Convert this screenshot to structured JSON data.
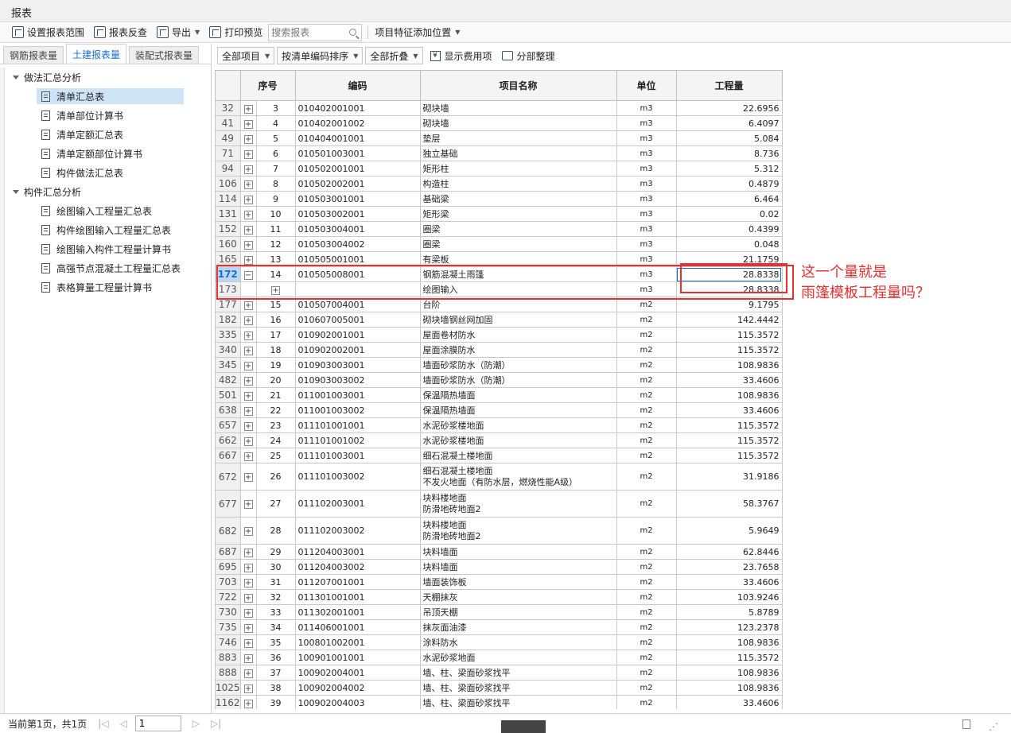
{
  "window": {
    "title": "报表"
  },
  "toolbar": {
    "set_range": "设置报表范围",
    "reverse_check": "报表反查",
    "export": "导出",
    "print_preview": "打印预览",
    "search_placeholder": "搜索报表",
    "feature_position": "项目特征添加位置"
  },
  "left_tabs": [
    "钢筋报表量",
    "土建报表量",
    "装配式报表量"
  ],
  "tree": {
    "groups": [
      {
        "label": "做法汇总分析",
        "items": [
          "清单汇总表",
          "清单部位计算书",
          "清单定额汇总表",
          "清单定额部位计算书",
          "构件做法汇总表"
        ]
      },
      {
        "label": "构件汇总分析",
        "items": [
          "绘图输入工程量汇总表",
          "构件绘图输入工程量汇总表",
          "绘图输入构件工程量计算书",
          "高强节点混凝土工程量汇总表",
          "表格算量工程量计算书"
        ]
      }
    ],
    "selected": "清单汇总表"
  },
  "right_toolbar": {
    "all_items": "全部项目",
    "sort_by_code": "按清单编码排序",
    "collapse_all": "全部折叠",
    "show_fee": "显示费用项",
    "section_arrange": "分部整理"
  },
  "table": {
    "headers": [
      "序号",
      "编码",
      "项目名称",
      "单位",
      "工程量"
    ],
    "rows": [
      {
        "rn": "32",
        "pm": "+",
        "seq": "3",
        "code": "010402001001",
        "name": "砌块墙",
        "unit": "m3",
        "qty": "22.6956"
      },
      {
        "rn": "41",
        "pm": "+",
        "seq": "4",
        "code": "010402001002",
        "name": "砌块墙",
        "unit": "m3",
        "qty": "6.4097"
      },
      {
        "rn": "49",
        "pm": "+",
        "seq": "5",
        "code": "010404001001",
        "name": "垫层",
        "unit": "m3",
        "qty": "5.084"
      },
      {
        "rn": "71",
        "pm": "+",
        "seq": "6",
        "code": "010501003001",
        "name": "独立基础",
        "unit": "m3",
        "qty": "8.736"
      },
      {
        "rn": "94",
        "pm": "+",
        "seq": "7",
        "code": "010502001001",
        "name": "矩形柱",
        "unit": "m3",
        "qty": "5.312"
      },
      {
        "rn": "106",
        "pm": "+",
        "seq": "8",
        "code": "010502002001",
        "name": "构造柱",
        "unit": "m3",
        "qty": "0.4879"
      },
      {
        "rn": "114",
        "pm": "+",
        "seq": "9",
        "code": "010503001001",
        "name": "基础梁",
        "unit": "m3",
        "qty": "6.464"
      },
      {
        "rn": "131",
        "pm": "+",
        "seq": "10",
        "code": "010503002001",
        "name": "矩形梁",
        "unit": "m3",
        "qty": "0.02"
      },
      {
        "rn": "152",
        "pm": "+",
        "seq": "11",
        "code": "010503004001",
        "name": "圈梁",
        "unit": "m3",
        "qty": "0.4399"
      },
      {
        "rn": "160",
        "pm": "+",
        "seq": "12",
        "code": "010503004002",
        "name": "圈梁",
        "unit": "m3",
        "qty": "0.048"
      },
      {
        "rn": "165",
        "pm": "+",
        "seq": "13",
        "code": "010505001001",
        "name": "有梁板",
        "unit": "m3",
        "qty": "21.1759"
      },
      {
        "rn": "172",
        "pm": "−",
        "seq": "14",
        "code": "010505008001",
        "name": "钢筋混凝土雨篷",
        "unit": "m3",
        "qty": "28.8338",
        "current": true
      },
      {
        "rn": "173",
        "pm": "",
        "sub": "+",
        "seq": "",
        "code": "",
        "name": "绘图输入",
        "unit": "m3",
        "qty": "28.8338"
      },
      {
        "rn": "177",
        "pm": "+",
        "seq": "15",
        "code": "010507004001",
        "name": "台阶",
        "unit": "m2",
        "qty": "9.1795"
      },
      {
        "rn": "182",
        "pm": "+",
        "seq": "16",
        "code": "010607005001",
        "name": "砌块墙钢丝网加固",
        "unit": "m2",
        "qty": "142.4442"
      },
      {
        "rn": "335",
        "pm": "+",
        "seq": "17",
        "code": "010902001001",
        "name": "屋面卷材防水",
        "unit": "m2",
        "qty": "115.3572"
      },
      {
        "rn": "340",
        "pm": "+",
        "seq": "18",
        "code": "010902002001",
        "name": "屋面涂膜防水",
        "unit": "m2",
        "qty": "115.3572"
      },
      {
        "rn": "345",
        "pm": "+",
        "seq": "19",
        "code": "010903003001",
        "name": "墙面砂浆防水（防潮）",
        "unit": "m2",
        "qty": "108.9836"
      },
      {
        "rn": "482",
        "pm": "+",
        "seq": "20",
        "code": "010903003002",
        "name": "墙面砂浆防水（防潮）",
        "unit": "m2",
        "qty": "33.4606"
      },
      {
        "rn": "501",
        "pm": "+",
        "seq": "21",
        "code": "011001003001",
        "name": "保温隔热墙面",
        "unit": "m2",
        "qty": "108.9836"
      },
      {
        "rn": "638",
        "pm": "+",
        "seq": "22",
        "code": "011001003002",
        "name": "保温隔热墙面",
        "unit": "m2",
        "qty": "33.4606"
      },
      {
        "rn": "657",
        "pm": "+",
        "seq": "23",
        "code": "011101001001",
        "name": "水泥砂浆楼地面",
        "unit": "m2",
        "qty": "115.3572"
      },
      {
        "rn": "662",
        "pm": "+",
        "seq": "24",
        "code": "011101001002",
        "name": "水泥砂浆楼地面",
        "unit": "m2",
        "qty": "115.3572"
      },
      {
        "rn": "667",
        "pm": "+",
        "seq": "25",
        "code": "011101003001",
        "name": "细石混凝土楼地面",
        "unit": "m2",
        "qty": "115.3572"
      },
      {
        "rn": "672",
        "pm": "+",
        "seq": "26",
        "code": "011101003002",
        "name": "细石混凝土楼地面",
        "name2": "不发火地面（有防水层，燃烧性能A级）",
        "unit": "m2",
        "qty": "31.9186"
      },
      {
        "rn": "677",
        "pm": "+",
        "seq": "27",
        "code": "011102003001",
        "name": "块料楼地面",
        "name2": "防滑地砖地面2",
        "unit": "m2",
        "qty": "58.3767"
      },
      {
        "rn": "682",
        "pm": "+",
        "seq": "28",
        "code": "011102003002",
        "name": "块料楼地面",
        "name2": "防滑地砖地面2",
        "unit": "m2",
        "qty": "5.9649"
      },
      {
        "rn": "687",
        "pm": "+",
        "seq": "29",
        "code": "011204003001",
        "name": "块料墙面",
        "unit": "m2",
        "qty": "62.8446"
      },
      {
        "rn": "695",
        "pm": "+",
        "seq": "30",
        "code": "011204003002",
        "name": "块料墙面",
        "unit": "m2",
        "qty": "23.7658"
      },
      {
        "rn": "703",
        "pm": "+",
        "seq": "31",
        "code": "011207001001",
        "name": "墙面装饰板",
        "unit": "m2",
        "qty": "33.4606"
      },
      {
        "rn": "722",
        "pm": "+",
        "seq": "32",
        "code": "011301001001",
        "name": "天棚抹灰",
        "unit": "m2",
        "qty": "103.9246"
      },
      {
        "rn": "730",
        "pm": "+",
        "seq": "33",
        "code": "011302001001",
        "name": "吊顶天棚",
        "unit": "m2",
        "qty": "5.8789"
      },
      {
        "rn": "735",
        "pm": "+",
        "seq": "34",
        "code": "011406001001",
        "name": "抹灰面油漆",
        "unit": "m2",
        "qty": "123.2378"
      },
      {
        "rn": "746",
        "pm": "+",
        "seq": "35",
        "code": "100801002001",
        "name": "涂料防水",
        "unit": "m2",
        "qty": "108.9836"
      },
      {
        "rn": "883",
        "pm": "+",
        "seq": "36",
        "code": "100901001001",
        "name": "水泥砂浆地面",
        "unit": "m2",
        "qty": "115.3572"
      },
      {
        "rn": "888",
        "pm": "+",
        "seq": "37",
        "code": "100902004001",
        "name": "墙、柱、梁面砂浆找平",
        "unit": "m2",
        "qty": "108.9836"
      },
      {
        "rn": "1025",
        "pm": "+",
        "seq": "38",
        "code": "100902004002",
        "name": "墙、柱、梁面砂浆找平",
        "unit": "m2",
        "qty": "108.9836"
      },
      {
        "rn": "1162",
        "pm": "+",
        "seq": "39",
        "code": "100902004003",
        "name": "墙、柱、梁面砂浆找平",
        "unit": "m2",
        "qty": "33.4606"
      }
    ]
  },
  "annotation": {
    "line1": "这一个量就是",
    "line2": "雨篷模板工程量吗？",
    "color": "#e83030"
  },
  "status": {
    "page_info": "当前第1页，共1页",
    "page_value": "1"
  }
}
